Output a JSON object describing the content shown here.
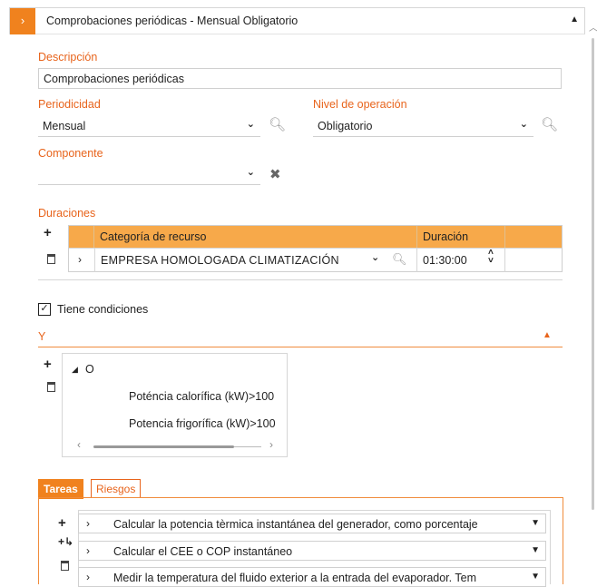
{
  "header": {
    "title": "Comprobaciones periódicas - Mensual Obligatorio",
    "expand_glyph": "›",
    "collapse_glyph": "▲"
  },
  "descripcion": {
    "label": "Descripción",
    "value": "Comprobaciones periódicas"
  },
  "periodicidad": {
    "label": "Periodicidad",
    "value": "Mensual"
  },
  "nivel": {
    "label": "Nivel de operación",
    "value": "Obligatorio"
  },
  "componente": {
    "label": "Componente",
    "value": ""
  },
  "duraciones": {
    "label": "Duraciones",
    "columns": [
      "Categoría de recurso",
      "Duración"
    ],
    "rows": [
      {
        "categoria": "EMPRESA HOMOLOGADA CLIMATIZACIÓN",
        "duracion": "01:30:00"
      }
    ]
  },
  "condiciones": {
    "checkbox_label": "Tiene condiciones",
    "checked": true,
    "group_label": "Y"
  },
  "tree": {
    "root": "O",
    "items": [
      "Poténcia calorífica (kW)>100",
      "Potencia frigorífica (kW)>100"
    ]
  },
  "tabs": {
    "active": "Tareas",
    "inactive": "Riesgos"
  },
  "tasks": [
    "Calcular la potencia tèrmica instantánea del generador, como porcentaje",
    "Calcular el CEE o COP instantáneo",
    "Medir la temperatura del fluido exterior a la entrada del evaporador. Tem"
  ],
  "icons": {
    "dropdown": "▾",
    "search": "⚲",
    "clear": "✕",
    "add": "+",
    "expand_row": "›",
    "tree_collapse": "◢",
    "spin": "⌃⌄"
  },
  "colors": {
    "accent": "#f0821e",
    "label": "#e8641c",
    "grid_header": "#f7a94a"
  }
}
